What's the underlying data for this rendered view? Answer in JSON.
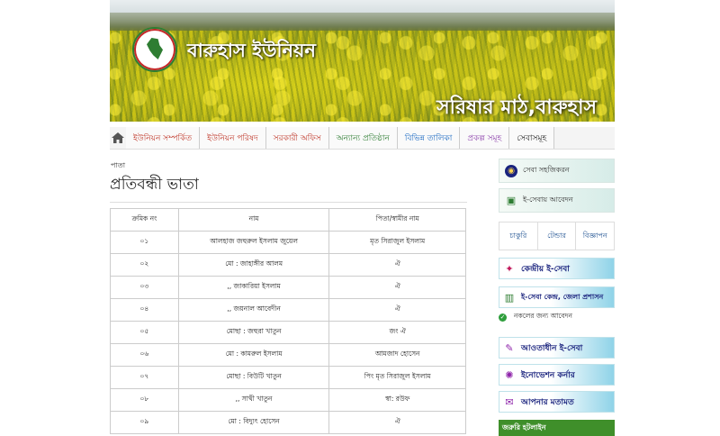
{
  "site": {
    "title": "বারুহাস ইউনিয়ন",
    "banner_caption": "সরিষার মাঠ,বারুহাস"
  },
  "nav": {
    "home_icon": "home-icon",
    "items": [
      {
        "label": "ইউনিয়ন সম্পর্কিত",
        "color": "#c0392b"
      },
      {
        "label": "ইউনিয়ন পরিষদ",
        "color": "#c0392b"
      },
      {
        "label": "সরকারী অফিস",
        "color": "#c0392b"
      },
      {
        "label": "অন্যান্য প্রতিষ্ঠান",
        "color": "#2e7d32"
      },
      {
        "label": "বিভিন্ন তালিকা",
        "color": "#1565c0"
      },
      {
        "label": "প্রকল্প সমূহ",
        "color": "#8e44ad"
      },
      {
        "label": "সেবাসমূহ",
        "color": "#222222"
      }
    ]
  },
  "content": {
    "breadcrumb": "পাতা",
    "title": "প্রতিবন্ধী ভাতা",
    "table": {
      "headers": [
        "ক্রমিক নং",
        "নাম",
        "পিতা/স্বামীর নাম"
      ],
      "rows": [
        [
          "০১",
          "আলহাজ জহুরুল ইসলাম জুয়েল",
          "মৃত সিরাজুল ইসলাম"
        ],
        [
          "০২",
          "মো : জাহাঙ্গীর আলম",
          "ঐ"
        ],
        [
          "০৩",
          ",, জাকারিয়া ইসলাম",
          "ঐ"
        ],
        [
          "০৪",
          ",, জয়নাল আবেদীন",
          "ঐ"
        ],
        [
          "০৫",
          "মোছা : জহুরা খাতুন",
          "জং ঐ"
        ],
        [
          "০৬",
          "মো : কামরুল ইসলাম",
          "আমজাদ হোসেন"
        ],
        [
          "০৭",
          "মোছা : বিউটি খাতুন",
          "পিং মৃত সিরাজুল ইসলাম"
        ],
        [
          "০৮",
          ",, সাথী খাতুন",
          "স্বা: রউফ"
        ],
        [
          "০৯",
          "মো : বিদ্যুৎ হোসেন",
          "ঐ"
        ]
      ]
    }
  },
  "sidebar": {
    "help_label": "সেবা সহজিকরন",
    "apply_label": "ই-সেবায় আবেদন",
    "tabs": [
      "চাকুরি",
      "টেন্ডার",
      "বিজ্ঞাপন"
    ],
    "boxes": {
      "central": "কেন্দ্রীয় ই-সেবা",
      "district": "ই-সেবা কেন্দ্র, জেলা প্রশাসন",
      "copy_apply": "নকলের জন্য আবেদন",
      "local": "আওতাধীন ই-সেবা",
      "innovation": "ইনোভেশন কর্নার",
      "opinion": "আপনার মতামত",
      "hotline": "জরুরি হটলাইন"
    }
  }
}
